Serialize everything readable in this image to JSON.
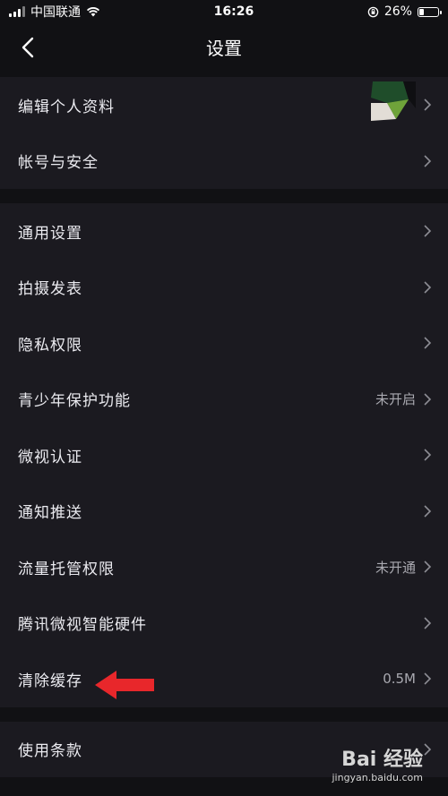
{
  "status_bar": {
    "carrier": "中国联通",
    "time": "16:26",
    "battery": "26%",
    "battery_level": 0.26
  },
  "header": {
    "title": "设置"
  },
  "groups": [
    {
      "items": [
        {
          "label": "编辑个人资料",
          "value": ""
        },
        {
          "label": "帐号与安全",
          "value": ""
        }
      ]
    },
    {
      "items": [
        {
          "label": "通用设置",
          "value": ""
        },
        {
          "label": "拍摄发表",
          "value": ""
        },
        {
          "label": "隐私权限",
          "value": ""
        },
        {
          "label": "青少年保护功能",
          "value": "未开启"
        },
        {
          "label": "微视认证",
          "value": ""
        },
        {
          "label": "通知推送",
          "value": ""
        },
        {
          "label": "流量托管权限",
          "value": "未开通"
        },
        {
          "label": "腾讯微视智能硬件",
          "value": ""
        },
        {
          "label": "清除缓存",
          "value": "0.5M"
        }
      ]
    },
    {
      "items": [
        {
          "label": "使用条款",
          "value": ""
        }
      ]
    }
  ],
  "annotation": {
    "arrow_color": "#e8272b"
  },
  "watermark": {
    "logo": "Bai 经验",
    "sub": "jingyan.baidu.com"
  }
}
